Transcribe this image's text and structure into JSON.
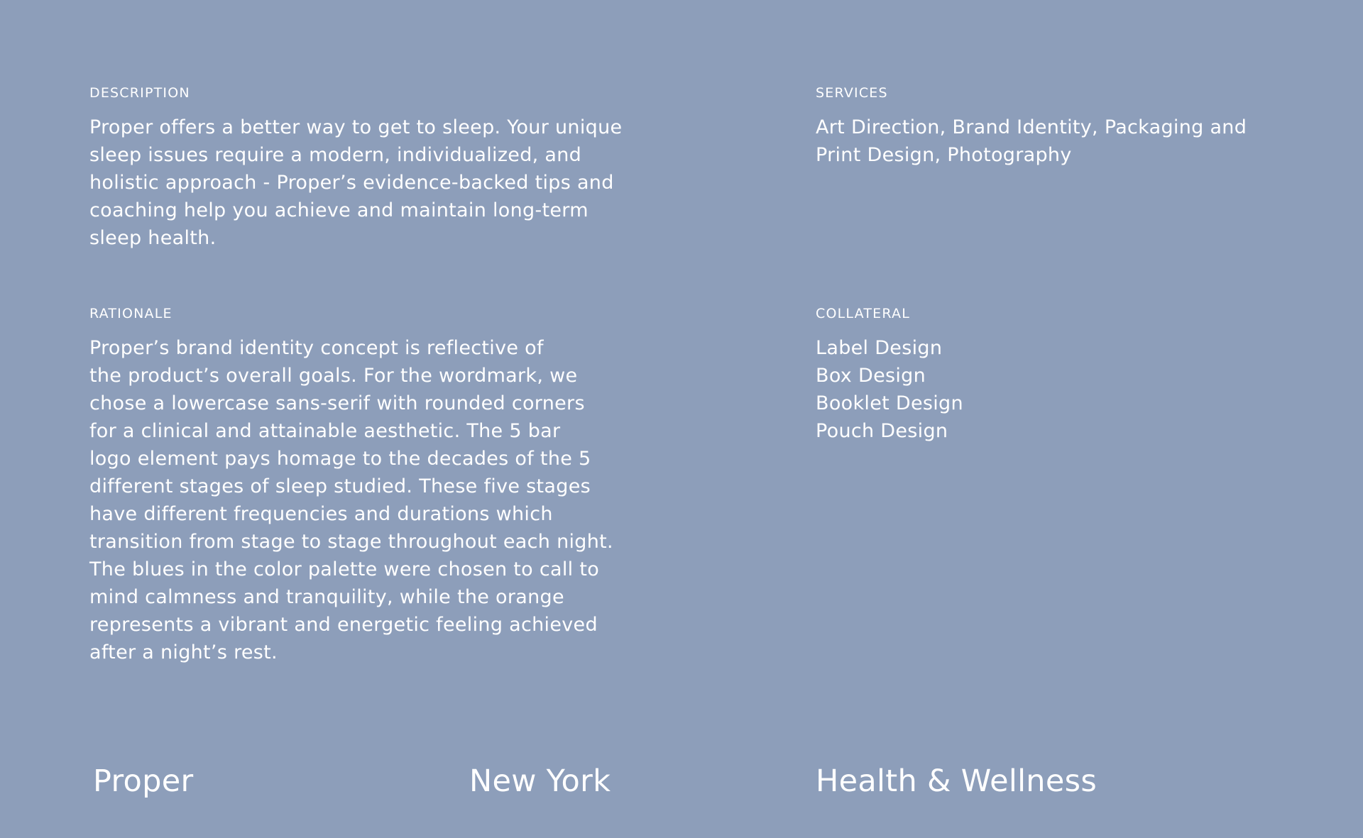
{
  "description": {
    "label": "DESCRIPTION",
    "text": "Proper offers a better way to get to sleep. Your unique\nsleep issues require a modern, individualized, and\nholistic approach - Proper’s evidence-backed tips and\ncoaching help you achieve and maintain long-term\nsleep health."
  },
  "services": {
    "label": "SERVICES",
    "text": "Art Direction, Brand Identity, Packaging and\nPrint Design, Photography"
  },
  "rationale": {
    "label": "RATIONALE",
    "text": "Proper’s brand identity concept is reflective of\nthe product’s overall goals. For the wordmark, we\nchose a  lowercase sans-serif with rounded corners\nfor a clinical and attainable aesthetic. The 5 bar\nlogo element pays homage to the decades of the 5\ndifferent stages of sleep studied. These five stages\nhave different frequencies and durations which\ntransition from stage to stage throughout each night.\nThe blues in the color palette were chosen to call to\nmind calmness and tranquility, while the orange\nrepresents a vibrant and energetic feeling achieved\nafter a night’s rest."
  },
  "collateral": {
    "label": "COLLATERAL",
    "items": [
      "Label Design",
      "Box Design",
      "Booklet Design",
      "Pouch Design"
    ]
  },
  "footer": {
    "client": "Proper",
    "location": "New York",
    "industry": "Health & Wellness"
  },
  "colors": {
    "background": "#8d9eba",
    "text": "#ffffff"
  }
}
